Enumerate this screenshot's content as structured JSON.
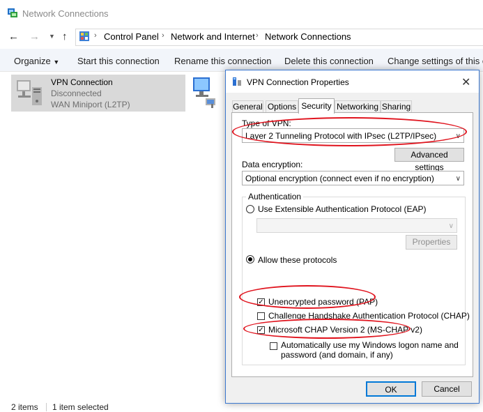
{
  "window": {
    "title": "Network Connections"
  },
  "address": {
    "crumbs": [
      "Control Panel",
      "Network and Internet",
      "Network Connections"
    ]
  },
  "commandbar": {
    "organize": "Organize",
    "start": "Start this connection",
    "rename": "Rename this connection",
    "delete": "Delete this connection",
    "change": "Change settings of this co"
  },
  "items": [
    {
      "name": "VPN Connection",
      "status": "Disconnected",
      "device": "WAN Miniport (L2TP)"
    }
  ],
  "statusbar": {
    "count": "2 items",
    "selected": "1 item selected"
  },
  "dialog": {
    "title": "VPN Connection Properties",
    "tabs": [
      "General",
      "Options",
      "Security",
      "Networking",
      "Sharing"
    ],
    "type_label": "Type of VPN:",
    "type_value": "Layer 2 Tunneling Protocol with IPsec (L2TP/IPsec)",
    "advanced_btn": "Advanced settings",
    "encryption_label": "Data encryption:",
    "encryption_value": "Optional encryption (connect even if no encryption)",
    "auth_group": "Authentication",
    "eap_radio": "Use Extensible Authentication Protocol (EAP)",
    "properties_btn": "Properties",
    "allow_radio": "Allow these protocols",
    "pap": "Unencrypted password (PAP)",
    "chap": "Challenge Handshake Authentication Protocol (CHAP)",
    "mschap": "Microsoft CHAP Version 2 (MS-CHAP v2)",
    "auto_logon_1": "Automatically use my Windows logon name and",
    "auto_logon_2": "password (and domain, if any)",
    "ok": "OK",
    "cancel": "Cancel"
  },
  "colors": {
    "accent": "#3b78d0",
    "highlight": "#e0141e"
  }
}
